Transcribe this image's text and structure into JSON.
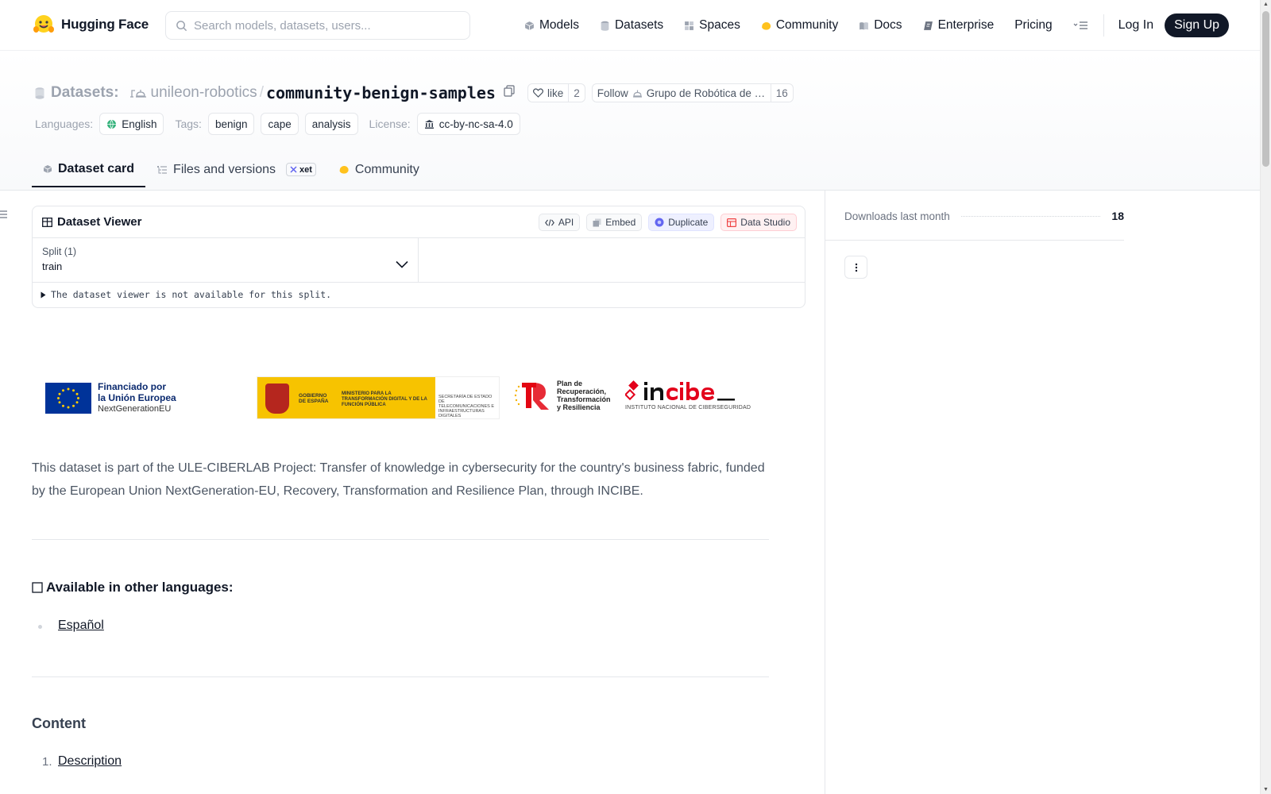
{
  "brand": {
    "name": "Hugging Face"
  },
  "search": {
    "placeholder": "Search models, datasets, users..."
  },
  "nav": {
    "items": [
      {
        "label": "Models"
      },
      {
        "label": "Datasets"
      },
      {
        "label": "Spaces"
      },
      {
        "label": "Community"
      },
      {
        "label": "Docs"
      },
      {
        "label": "Enterprise"
      },
      {
        "label": "Pricing"
      }
    ],
    "login": "Log In",
    "signup": "Sign Up"
  },
  "repo": {
    "type_label": "Datasets:",
    "owner": "unileon-robotics",
    "separator": "/",
    "name": "community-benign-samples",
    "like_label": "like",
    "like_count": "2",
    "follow_label": "Follow",
    "follow_org": "Grupo de Robótica de la Universidad de León",
    "follow_count": "16"
  },
  "tags": {
    "languages_label": "Languages:",
    "languages": [
      "English"
    ],
    "tags_label": "Tags:",
    "tags": [
      "benign",
      "cape",
      "analysis"
    ],
    "license_label": "License:",
    "license": "cc-by-nc-sa-4.0"
  },
  "tabs": [
    {
      "label": "Dataset card",
      "active": true
    },
    {
      "label": "Files and versions",
      "badge": "xet"
    },
    {
      "label": "Community"
    }
  ],
  "viewer": {
    "title": "Dataset Viewer",
    "actions": [
      "API",
      "Embed",
      "Duplicate",
      "Data Studio"
    ],
    "split_label": "Split (1)",
    "split_value": "train",
    "message": "The dataset viewer is not available for this split."
  },
  "logos": {
    "eu_line1": "Financiado por",
    "eu_line2": "la Unión Europea",
    "eu_line3": "NextGenerationEU",
    "gob_1": "GOBIERNO DE ESPAÑA",
    "gob_2": "MINISTERIO PARA LA TRANSFORMACIÓN DIGITAL Y DE LA FUNCIÓN PÚBLICA",
    "gob_3": "SECRETARÍA DE ESTADO DE TELECOMUNICACIONES E INFRAESTRUCTURAS DIGITALES",
    "prtr_1": "Plan de",
    "prtr_2": "Recuperación,",
    "prtr_3": "Transformación",
    "prtr_4": "y Resiliencia",
    "incibe_sub": "INSTITUTO NACIONAL DE CIBERSEGURIDAD"
  },
  "card": {
    "intro": "This dataset is part of the ULE-CIBERLAB Project: Transfer of knowledge in cybersecurity for the country's business fabric, funded by the European Union NextGeneration-EU, Recovery, Transformation and Resilience Plan, through INCIBE.",
    "langs_heading": "Available in other languages:",
    "lang_link": "Español",
    "content_heading": "Content",
    "content_items": [
      {
        "num": "1.",
        "label": "Description"
      }
    ]
  },
  "sidebar": {
    "downloads_label": "Downloads last month",
    "downloads_value": "18"
  }
}
